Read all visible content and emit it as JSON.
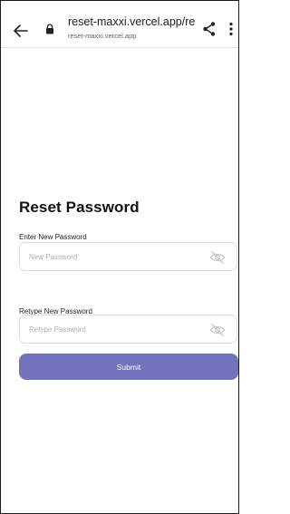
{
  "browser": {
    "url_title": "reset-maxxi.vercel.app/re...",
    "url_subtitle": "reset-maxxi.vercel.app",
    "icons": [
      "back-arrow-icon",
      "lock-icon",
      "share-icon",
      "more-vert-icon"
    ]
  },
  "form": {
    "title": "Reset Password",
    "new_password": {
      "label": "Enter New Password",
      "placeholder": "New Password",
      "value": ""
    },
    "retype_password": {
      "label": "Retype New Password",
      "placeholder": "Retype Password",
      "value": ""
    },
    "submit_label": "Submit",
    "accent_color": "#7273bc"
  }
}
